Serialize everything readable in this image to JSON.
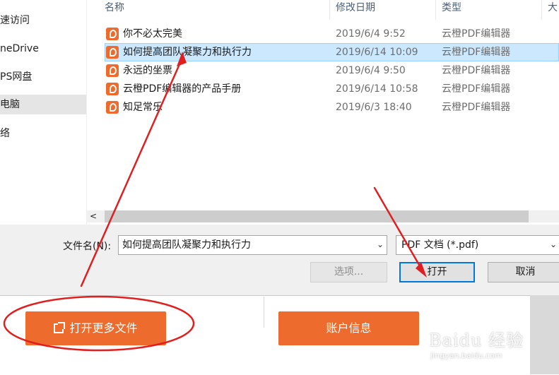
{
  "nav": {
    "items": [
      {
        "label": "速访问",
        "selected": false
      },
      {
        "label": "neDrive",
        "selected": false
      },
      {
        "label": "PS网盘",
        "selected": false
      },
      {
        "label": "电脑",
        "selected": true
      },
      {
        "label": "络",
        "selected": false
      }
    ]
  },
  "filelist": {
    "columns": {
      "name": "名称",
      "date": "修改日期",
      "type": "类型",
      "size": "大"
    },
    "scroll_left_glyph": "<",
    "rows": [
      {
        "name": "你不必太完美",
        "date": "2019/6/4 9:52",
        "type": "云橙PDF编辑器",
        "selected": false
      },
      {
        "name": "如何提高团队凝聚力和执行力",
        "date": "2019/6/14 10:09",
        "type": "云橙PDF编辑器",
        "selected": true
      },
      {
        "name": "永远的坐票",
        "date": "2019/6/4 9:50",
        "type": "云橙PDF编辑器",
        "selected": false
      },
      {
        "name": "云橙PDF编辑器的产品手册",
        "date": "2019/6/14 10:58",
        "type": "云橙PDF编辑器",
        "selected": false
      },
      {
        "name": "知足常乐",
        "date": "2019/6/3 18:40",
        "type": "云橙PDF编辑器",
        "selected": false
      }
    ]
  },
  "filename": {
    "label": "文件名(N):",
    "value": "如何提高团队凝聚力和执行力"
  },
  "filetype": {
    "value": "PDF 文档 (*.pdf)"
  },
  "buttons": {
    "options": "选项...",
    "open": "打开",
    "cancel": "取消"
  },
  "host": {
    "open_more": "打开更多文件",
    "account": "账户信息"
  },
  "watermark": {
    "brand": "Baidu 经验",
    "url": "jingyan.baidu.com"
  },
  "colors": {
    "accent_orange": "#ed6b2c",
    "selection_blue": "#cce8ff",
    "annotation_red": "#e02020",
    "default_button_border": "#0078d7"
  }
}
